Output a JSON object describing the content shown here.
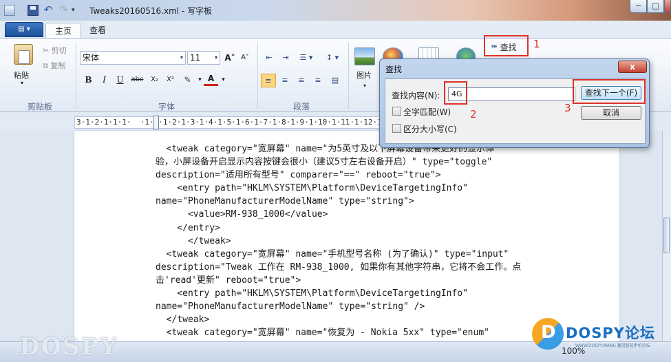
{
  "window": {
    "title": "Tweaks20160516.xml - 写字板",
    "minimize": "─",
    "maximize": "□",
    "close": ""
  },
  "quick_access": {
    "undo": "↶",
    "redo": "↷",
    "dropdown": "▾"
  },
  "ribbon": {
    "app_menu": "▤ ▾",
    "tabs": [
      {
        "label": "主页",
        "active": true
      },
      {
        "label": "查看",
        "active": false
      }
    ],
    "clipboard": {
      "group_label": "剪贴板",
      "paste": "粘贴",
      "paste_arrow": "▾",
      "cut": "剪切",
      "copy": "复制"
    },
    "font": {
      "group_label": "字体",
      "font_name": "宋体",
      "font_size": "11",
      "grow": "A˄",
      "shrink": "A˅",
      "bold": "B",
      "italic": "I",
      "underline": "U",
      "strike": "abc",
      "subscript": "X₂",
      "superscript": "X²",
      "highlight": "✎",
      "font_color": "A"
    },
    "paragraph": {
      "group_label": "段落"
    },
    "insert": {
      "picture": "图片",
      "picture_arrow": "▾"
    },
    "find": {
      "label": "查找",
      "icon": "binoculars-icon"
    }
  },
  "annotations": {
    "one": "1",
    "two": "2",
    "three": "3",
    "color": "#e0312b"
  },
  "ruler": "3·1·2·1·1·1·  ·1·1·1·2·1·3·1·4·1·5·1·6·1·7·1·8·1·9·1·10·1·11·1·12·1·13·1·14·1·15·1·16·1·17·1",
  "find_dialog": {
    "title": "查找",
    "close": "x",
    "label": "查找内容(N):",
    "value": "4G",
    "match_whole_word": "全字匹配(W)",
    "match_case": "区分大小写(C)",
    "find_next": "查找下一个(F)",
    "cancel": "取消"
  },
  "document": {
    "lines": [
      "  <tweak category=\"宽屏幕\" name=\"为5英寸及以下屏幕设备带来更好的显示体",
      "验，小屏设备开启显示内容按键会很小（建议5寸左右设备开启）\" type=\"toggle\"",
      "description=\"适用所有型号\" comparer=\"==\" reboot=\"true\">",
      "    <entry path=\"HKLM\\SYSTEM\\Platform\\DeviceTargetingInfo\"",
      "name=\"PhoneManufacturerModelName\" type=\"string\">",
      "      <value>RM-938_1000</value>",
      "    </entry>",
      "      </tweak>",
      "  <tweak category=\"宽屏幕\" name=\"手机型号名称 (为了确认)\" type=\"input\"",
      "description=\"Tweak 工作在 RM-938_1000, 如果你有其他字符串，它将不会工作。点",
      "击'read'更新\" reboot=\"true\">",
      "    <entry path=\"HKLM\\SYSTEM\\Platform\\DeviceTargetingInfo\"",
      "name=\"PhoneManufacturerModelName\" type=\"string\" />",
      "  </tweak>",
      "  <tweak category=\"宽屏幕\" name=\"恢复为 - Nokia 5xx\" type=\"enum\""
    ]
  },
  "statusbar": {
    "zoom": "100%"
  },
  "watermarks": {
    "left": "DOSPY",
    "brand": "DOSPY论坛",
    "url": "WWW.DOSPY.WANG 塞班智能手机论坛"
  }
}
